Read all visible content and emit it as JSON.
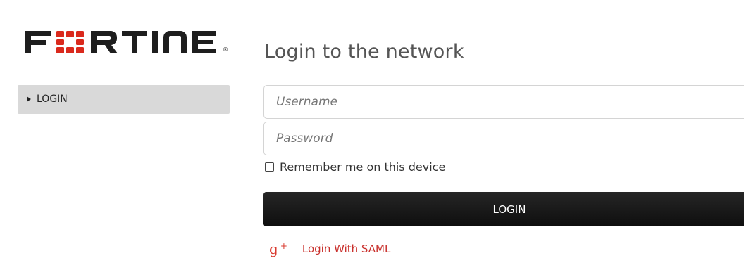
{
  "brand": {
    "logo_text": "FORTINET",
    "registered_mark": "®",
    "accent_color": "#da291c"
  },
  "sidebar": {
    "items": [
      {
        "label": "LOGIN",
        "icon": "caret-right-icon",
        "selected": true
      }
    ]
  },
  "main": {
    "title": "Login to the network",
    "username": {
      "placeholder": "Username",
      "value": ""
    },
    "password": {
      "placeholder": "Password",
      "value": ""
    },
    "remember": {
      "label": "Remember me on this device",
      "checked": false
    },
    "login_button": {
      "label": "LOGIN"
    },
    "saml": {
      "icon": "google-plus-icon",
      "icon_text": "g",
      "icon_plus": "+",
      "label": "Login With SAML",
      "color": "#c9302c"
    }
  }
}
